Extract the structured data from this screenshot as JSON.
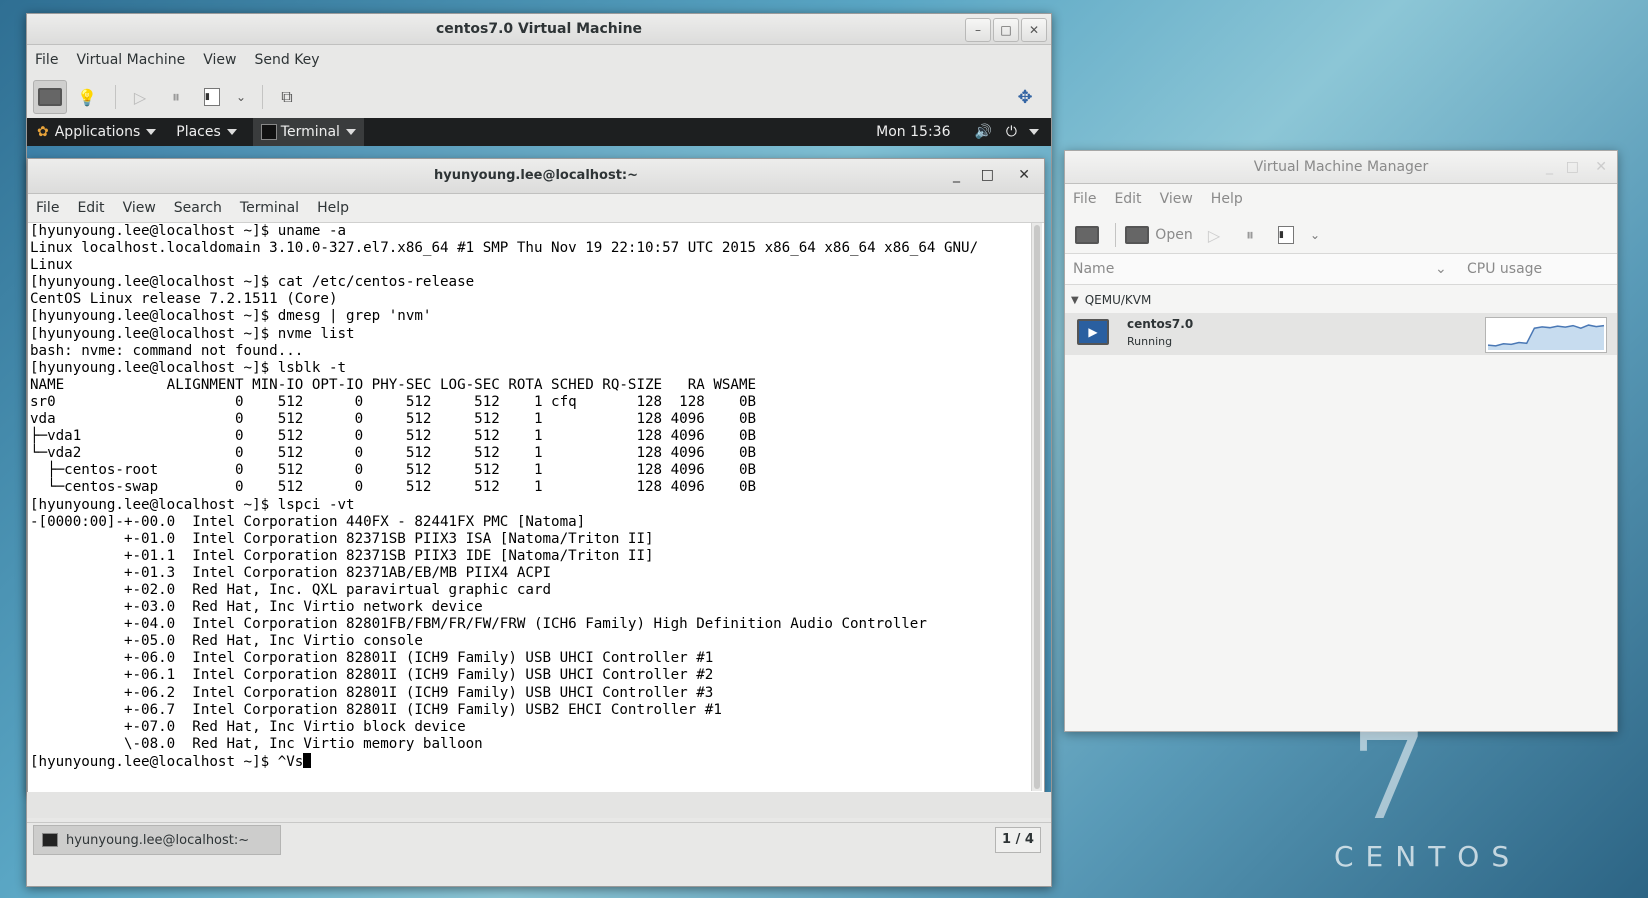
{
  "viewer": {
    "title": "centos7.0 Virtual Machine",
    "menu": [
      "File",
      "Virtual Machine",
      "View",
      "Send Key"
    ],
    "min": "–",
    "max": "□",
    "close": "✕"
  },
  "guest": {
    "topbar": {
      "applications": "Applications",
      "places": "Places",
      "terminal": "Terminal",
      "clock": "Mon 15:36"
    },
    "taskbar": {
      "item": "hyunyoung.lee@localhost:~",
      "pager": "1 / 4"
    }
  },
  "terminal": {
    "title": "hyunyoung.lee@localhost:~",
    "menu": [
      "File",
      "Edit",
      "View",
      "Search",
      "Terminal",
      "Help"
    ],
    "lines": [
      "[hyunyoung.lee@localhost ~]$ uname -a",
      "Linux localhost.localdomain 3.10.0-327.el7.x86_64 #1 SMP Thu Nov 19 22:10:57 UTC 2015 x86_64 x86_64 x86_64 GNU/",
      "Linux",
      "[hyunyoung.lee@localhost ~]$ cat /etc/centos-release",
      "CentOS Linux release 7.2.1511 (Core)",
      "[hyunyoung.lee@localhost ~]$ dmesg | grep 'nvm'",
      "[hyunyoung.lee@localhost ~]$ nvme list",
      "bash: nvme: command not found...",
      "[hyunyoung.lee@localhost ~]$ lsblk -t",
      "NAME            ALIGNMENT MIN-IO OPT-IO PHY-SEC LOG-SEC ROTA SCHED RQ-SIZE   RA WSAME",
      "sr0                     0    512      0     512     512    1 cfq       128  128    0B",
      "vda                     0    512      0     512     512    1           128 4096    0B",
      "├─vda1                  0    512      0     512     512    1           128 4096    0B",
      "└─vda2                  0    512      0     512     512    1           128 4096    0B",
      "  ├─centos-root         0    512      0     512     512    1           128 4096    0B",
      "  └─centos-swap         0    512      0     512     512    1           128 4096    0B",
      "[hyunyoung.lee@localhost ~]$ lspci -vt",
      "-[0000:00]-+-00.0  Intel Corporation 440FX - 82441FX PMC [Natoma]",
      "           +-01.0  Intel Corporation 82371SB PIIX3 ISA [Natoma/Triton II]",
      "           +-01.1  Intel Corporation 82371SB PIIX3 IDE [Natoma/Triton II]",
      "           +-01.3  Intel Corporation 82371AB/EB/MB PIIX4 ACPI",
      "           +-02.0  Red Hat, Inc. QXL paravirtual graphic card",
      "           +-03.0  Red Hat, Inc Virtio network device",
      "           +-04.0  Intel Corporation 82801FB/FBM/FR/FW/FRW (ICH6 Family) High Definition Audio Controller",
      "           +-05.0  Red Hat, Inc Virtio console",
      "           +-06.0  Intel Corporation 82801I (ICH9 Family) USB UHCI Controller #1",
      "           +-06.1  Intel Corporation 82801I (ICH9 Family) USB UHCI Controller #2",
      "           +-06.2  Intel Corporation 82801I (ICH9 Family) USB UHCI Controller #3",
      "           +-06.7  Intel Corporation 82801I (ICH9 Family) USB2 EHCI Controller #1",
      "           +-07.0  Red Hat, Inc Virtio block device",
      "           \\-08.0  Red Hat, Inc Virtio memory balloon"
    ],
    "prompt": "[hyunyoung.lee@localhost ~]$ ^Vs"
  },
  "vmm": {
    "title": "Virtual Machine Manager",
    "menu": [
      "File",
      "Edit",
      "View",
      "Help"
    ],
    "open_label": "Open",
    "col_name": "Name",
    "col_cpu": "CPU usage",
    "group": "QEMU/KVM",
    "vm_name": "centos7.0",
    "vm_status": "Running",
    "cpu_history": [
      0.15,
      0.12,
      0.2,
      0.18,
      0.25,
      0.22,
      0.8,
      0.85,
      0.82,
      0.88,
      0.84,
      0.9,
      0.8,
      0.92,
      0.86,
      0.9
    ]
  },
  "wallpaper": {
    "seven": "7",
    "word": "CENTOS"
  },
  "colors": {
    "gnome_bar": "#1d1f20",
    "selected_row": "#e4e4e3"
  }
}
